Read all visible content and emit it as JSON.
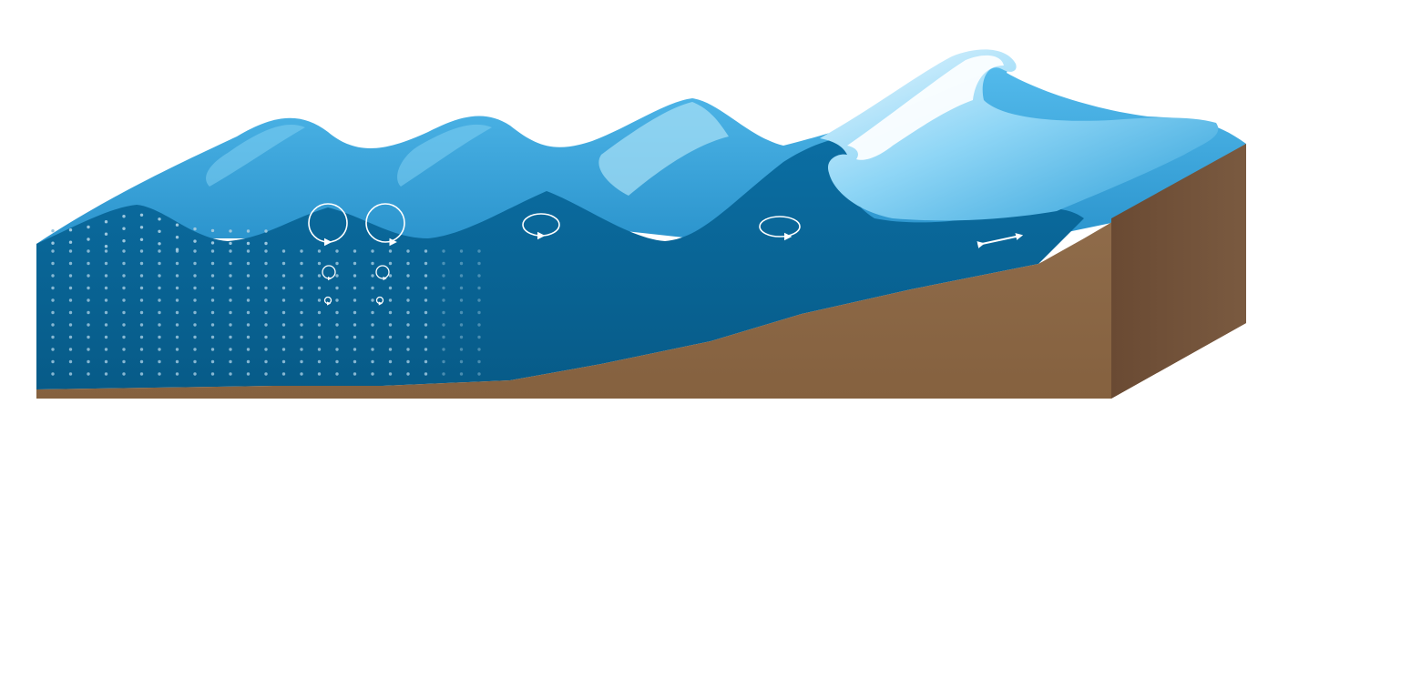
{
  "diagram": {
    "orbit_icons": [
      {
        "name": "orbit-large-left-icon",
        "kind": "circle"
      },
      {
        "name": "orbit-large-right-icon",
        "kind": "circle"
      },
      {
        "name": "orbit-medium-left-icon",
        "kind": "circle"
      },
      {
        "name": "orbit-medium-right-icon",
        "kind": "circle"
      },
      {
        "name": "orbit-small-left-icon",
        "kind": "circle"
      },
      {
        "name": "orbit-small-right-icon",
        "kind": "circle"
      },
      {
        "name": "orbit-ellipse-mid-icon",
        "kind": "ellipse"
      },
      {
        "name": "orbit-ellipse-shoaling-icon",
        "kind": "ellipse"
      },
      {
        "name": "back-and-forth-arrow-icon",
        "kind": "double-arrow"
      }
    ],
    "colors": {
      "deep_water": "#0a6b9e",
      "surface_water": "#3aa8dd",
      "light_water": "#7fd0f2",
      "foam": "#ffffff",
      "seabed": "#8a6548",
      "seabed_side": "#6e4e37",
      "dots": "#9cc7de"
    }
  }
}
